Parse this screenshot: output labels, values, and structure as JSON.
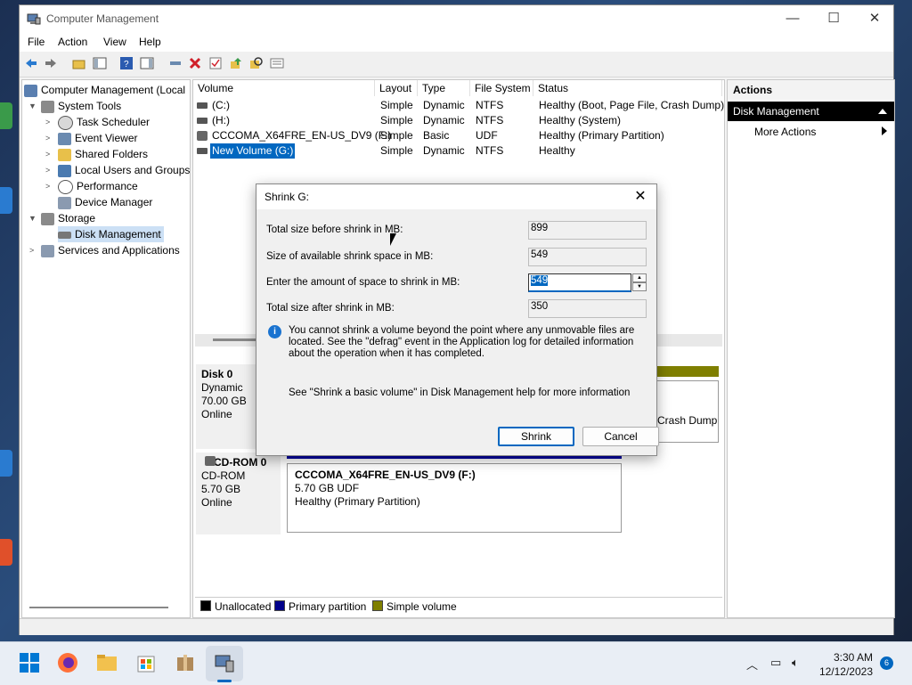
{
  "window": {
    "title": "Computer Management",
    "minimize": "—",
    "maximize": "☐",
    "close": "✕"
  },
  "menu": [
    "File",
    "Action",
    "View",
    "Help"
  ],
  "tree": {
    "root": "Computer Management (Local",
    "system_tools": "System Tools",
    "task_scheduler": "Task Scheduler",
    "event_viewer": "Event Viewer",
    "shared_folders": "Shared Folders",
    "local_users": "Local Users and Groups",
    "performance": "Performance",
    "device_manager": "Device Manager",
    "storage": "Storage",
    "disk_management": "Disk Management",
    "services": "Services and Applications"
  },
  "volume_table": {
    "headers": [
      "Volume",
      "Layout",
      "Type",
      "File System",
      "Status"
    ],
    "rows": [
      [
        "(C:)",
        "Simple",
        "Dynamic",
        "NTFS",
        "Healthy (Boot, Page File, Crash Dump)"
      ],
      [
        "(H:)",
        "Simple",
        "Dynamic",
        "NTFS",
        "Healthy (System)"
      ],
      [
        "CCCOMA_X64FRE_EN-US_DV9 (F:)",
        "Simple",
        "Basic",
        "UDF",
        "Healthy (Primary Partition)"
      ],
      [
        "New Volume (G:)",
        "Simple",
        "Dynamic",
        "NTFS",
        "Healthy"
      ]
    ]
  },
  "disk0": {
    "name": "Disk 0",
    "type": "Dynamic",
    "size": "70.00 GB",
    "state": "Online",
    "partial_text": "Crash Dump"
  },
  "cdrom0": {
    "name": "CD-ROM 0",
    "type": "CD-ROM",
    "size": "5.70 GB",
    "state": "Online",
    "part_name": "CCCOMA_X64FRE_EN-US_DV9  (F:)",
    "part_size": "5.70 GB UDF",
    "part_status": "Healthy (Primary Partition)"
  },
  "legend": {
    "unallocated": "Unallocated",
    "primary": "Primary partition",
    "simple": "Simple volume"
  },
  "colors": {
    "unallocated": "#000000",
    "primary": "#00008b",
    "simple": "#7f7f00",
    "accent": "#0067c0"
  },
  "actions": {
    "header": "Actions",
    "section": "Disk Management",
    "more": "More Actions"
  },
  "dialog": {
    "title": "Shrink G:",
    "label_total_before": "Total size before shrink in MB:",
    "value_total_before": "899",
    "label_available": "Size of available shrink space in MB:",
    "value_available": "549",
    "label_enter": "Enter the amount of space to shrink in MB:",
    "value_enter": "549",
    "label_total_after": "Total size after shrink in MB:",
    "value_total_after": "350",
    "info_text": "You cannot shrink a volume beyond the point where any unmovable files are located. See the \"defrag\" event in the Application log for detailed information about the operation when it has completed.",
    "help_text": "See \"Shrink a basic volume\" in Disk Management help for more information",
    "shrink_button": "Shrink",
    "cancel_button": "Cancel"
  },
  "taskbar": {
    "time": "3:30 AM",
    "date": "12/12/2023",
    "notifications": "6"
  }
}
